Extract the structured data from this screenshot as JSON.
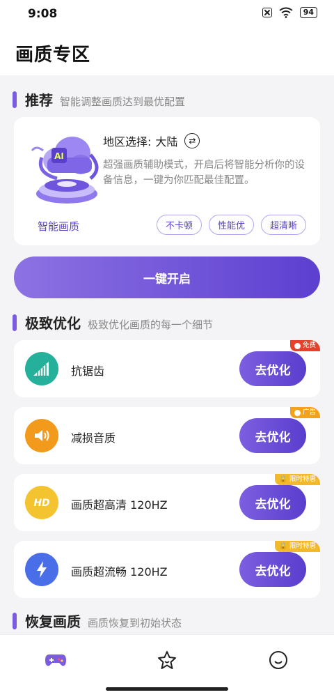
{
  "status_bar": {
    "time": "9:08",
    "battery": "94"
  },
  "header": {
    "title": "画质专区"
  },
  "recommend": {
    "title": "推荐",
    "subtitle": "智能调整画质达到最优配置",
    "region_label": "地区选择:",
    "region_value": "大陆",
    "description": "超强画质辅助模式，开启后将智能分析你的设备信息，一键为你匹配最佳配置。",
    "illustration_label": "智能画质",
    "tags": [
      "不卡顿",
      "性能优",
      "超清晰"
    ],
    "one_key_button": "一键开启"
  },
  "optimize": {
    "title": "极致优化",
    "subtitle": "极致优化画质的每一个细节",
    "items": [
      {
        "label": "抗锯齿",
        "button": "去优化",
        "badge": "免费",
        "badge_color": "#e8402a",
        "icon": "signal-bars-icon",
        "icon_color": "#24b09a"
      },
      {
        "label": "减损音质",
        "button": "去优化",
        "badge": "广告",
        "badge_color": "#f2a31b",
        "icon": "speaker-icon",
        "icon_color": "#f29a1c"
      },
      {
        "label": "画质超高清 120HZ",
        "button": "去优化",
        "badge": "限时特惠",
        "badge_color": "#f4b92a",
        "icon": "hd-icon",
        "icon_color": "#f3c330"
      },
      {
        "label": "画质超流畅 120HZ",
        "button": "去优化",
        "badge": "限时特惠",
        "badge_color": "#f4b92a",
        "icon": "lightning-icon",
        "icon_color": "#4a6ee8"
      }
    ]
  },
  "restore": {
    "title": "恢复画质",
    "subtitle": "画质恢复到初始状态"
  },
  "colors": {
    "accent": "#6a4bd8",
    "accent_light": "#8c72e3",
    "background": "#f4f4f6"
  }
}
